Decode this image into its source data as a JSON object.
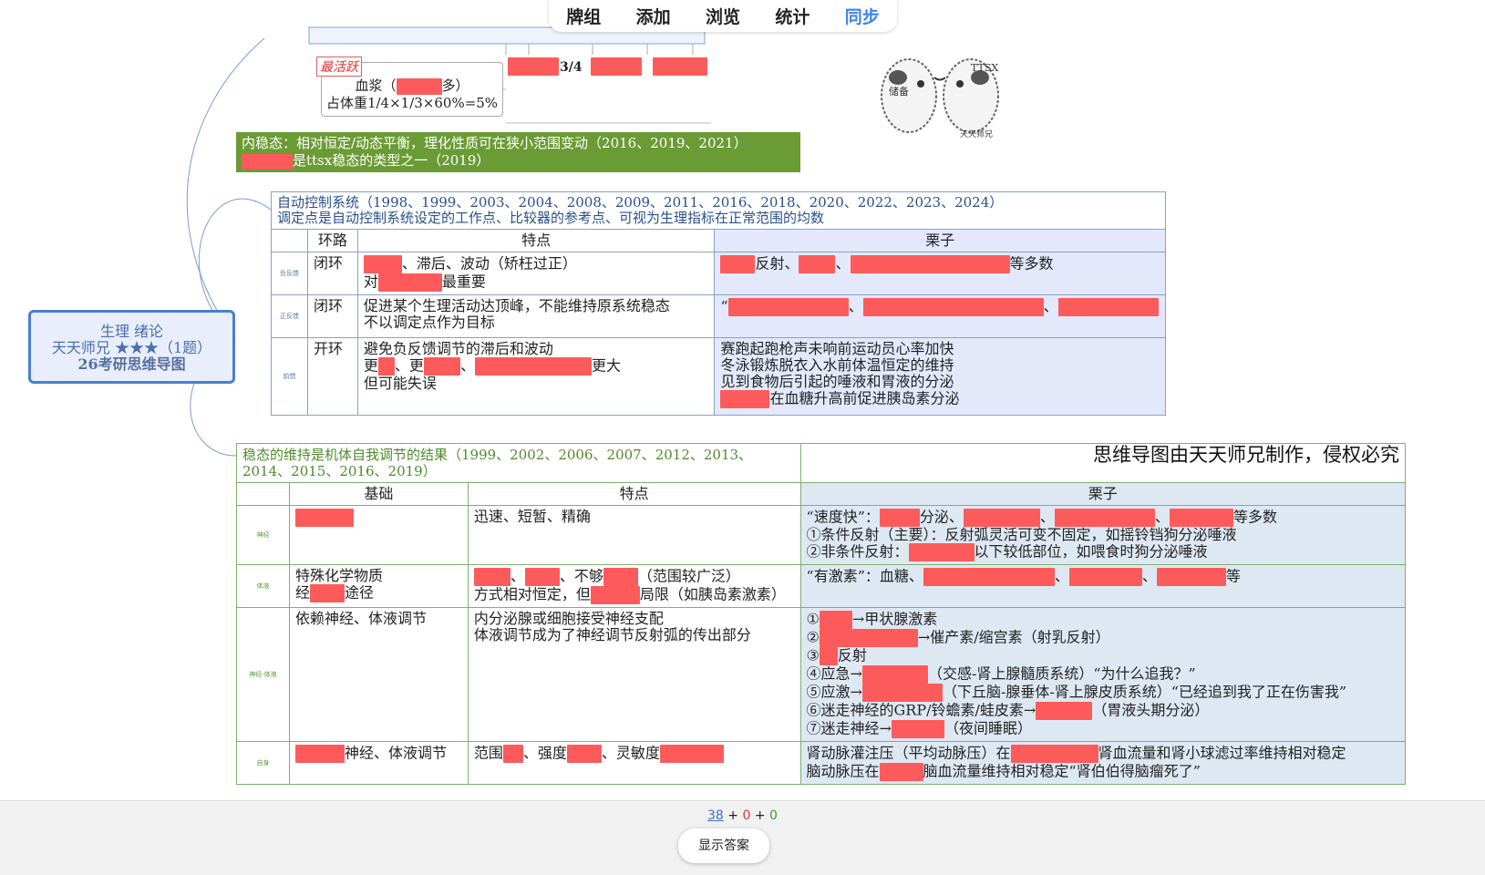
{
  "nav": {
    "tabs": [
      "牌组",
      "添加",
      "浏览",
      "统计",
      "同步"
    ],
    "active": "同步"
  },
  "central": {
    "line1": "生理 绪论",
    "line2": "天天师兄 ★★★（1题）",
    "line3": "26考研思维导图"
  },
  "plasma": {
    "tag": "最活跃",
    "line1_pre": "血浆（",
    "line1_post": "多）",
    "line2": "占体重1/4×1/3×60%=5%",
    "fraction": "3/4"
  },
  "logo_text": [
    "储备",
    "TTSX",
    "天天师兄"
  ],
  "homeostasis": {
    "line1": "内稳态：相对恒定/动态平衡，理化性质可在狭小范围变动（2016、2019、2021）",
    "line2": "是ttsx稳态的类型之一（2019）"
  },
  "control": {
    "title": "自动控制系统（1998、1999、2003、2004、2008、2009、2011、2016、2018、2020、2022、2023、2024）",
    "subtitle": "调定点是自动控制系统设定的工作点、比较器的参考点、可视为生理指标在正常范围的均数",
    "headers": [
      "环路",
      "特点",
      "栗子"
    ],
    "rows": [
      {
        "tag": "负反馈",
        "loop": "闭环",
        "feat1": "、滞后、波动（矫枉过正）",
        "feat2_pre": "对",
        "feat2_post": "最重要",
        "ex1": "反射、",
        "ex2": "等多数"
      },
      {
        "tag": "正反馈",
        "loop": "闭环",
        "feat1": "促进某个生理活动达顶峰，不能维持原系统稳态",
        "feat2": "不以调定点作为目标",
        "ex_pre": "“",
        "sep": "、"
      },
      {
        "tag": "前馈",
        "loop": "开环",
        "feat1": "避免负反馈调节的滞后和波动",
        "feat2_a": "更",
        "feat2_b": "、更",
        "feat2_c": "更大",
        "feat3": "但可能失误",
        "ex1": "赛跑起跑枪声未响前运动员心率加快",
        "ex2": "冬泳锻炼脱衣入水前体温恒定的维持",
        "ex3": "见到食物后引起的唾液和胃液的分泌",
        "ex4": "在血糖升高前促进胰岛素分泌"
      }
    ]
  },
  "regulation": {
    "title": "稳态的维持是机体自我调节的结果（1999、2002、2006、2007、2012、2013、2014、2015、2016、2019）",
    "note": "思维导图由天天师兄制作，侵权必究",
    "headers": [
      "基础",
      "特点",
      "栗子"
    ],
    "rows": [
      {
        "tag": "神经",
        "feat": "迅速、短暂、精确",
        "ex1_pre": "“速度快”：",
        "ex1_mid": "分泌、",
        "ex1_post": "等多数",
        "ex2": "①条件反射（主要）：反射弧灵活可变不固定，如摇铃铛狗分泌唾液",
        "ex3_pre": "②非条件反射：",
        "ex3_post": "以下较低部位，如喂食时狗分泌唾液"
      },
      {
        "tag": "体液",
        "base1": "特殊化学物质",
        "base2_pre": "经",
        "base2_post": "途径",
        "feat1_a": "、",
        "feat1_b": "、不够",
        "feat1_c": "（范围较广泛）",
        "feat2_pre": "方式相对恒定，但",
        "feat2_post": "局限（如胰岛素激素）",
        "ex_pre": "“有激素”：血糖、",
        "ex_post": "等"
      },
      {
        "tag": "神经-体液",
        "base": "依赖神经、体液调节",
        "feat1": "内分泌腺或细胞接受神经支配",
        "feat2": "体液调节成为了神经调节反射弧的传出部分",
        "e1_pre": "①",
        "e1_post": "→甲状腺激素",
        "e2_pre": "②",
        "e2_post": "→催产素/缩宫素（射乳反射）",
        "e3_pre": "③",
        "e3_post": "反射",
        "e4_pre": "④应急→",
        "e4_post": "（交感-肾上腺髓质系统）“为什么追我？”",
        "e5_pre": "⑤应激→",
        "e5_post": "（下丘脑-腺垂体-肾上腺皮质系统）“已经追到我了正在伤害我”",
        "e6_pre": "⑥迷走神经的GRP/铃蟾素/蛙皮素→",
        "e6_post": "（胃液头期分泌）",
        "e7_pre": "⑦迷走神经→",
        "e7_post": "（夜间睡眠）"
      },
      {
        "tag": "自身",
        "base_post": "神经、体液调节",
        "feat_a": "范围",
        "feat_b": "、强度",
        "feat_c": "、灵敏度",
        "ex1_pre": "肾动脉灌注压（平均动脉压）在",
        "ex1_post": "肾血流量和肾小球滤过率维持相对稳定",
        "ex2_pre": "脑动脉压在",
        "ex2_post": "脑血流量维持相对稳定“肾伯伯得脑瘤死了”"
      }
    ]
  },
  "review": {
    "new": "38",
    "plus": "+",
    "learn": "0",
    "review": "0",
    "button": "显示答案"
  }
}
